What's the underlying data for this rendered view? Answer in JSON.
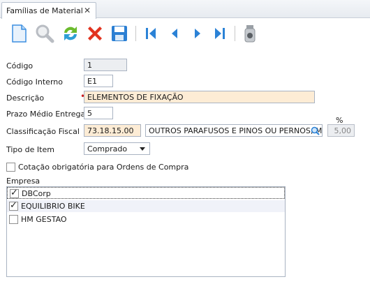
{
  "tab": {
    "title": "Famílias de Material",
    "close": "✕"
  },
  "toolbar": {
    "new": "new-document-icon",
    "search": "search-icon",
    "refresh": "refresh-icon",
    "delete": "delete-icon",
    "save": "save-icon",
    "first": "first-record-icon",
    "prev": "previous-record-icon",
    "next": "next-record-icon",
    "last": "last-record-icon",
    "extra": "dispenser-icon"
  },
  "form": {
    "codigo_label": "Código",
    "codigo_value": "1",
    "codigo_interno_label": "Código Interno",
    "codigo_interno_value": "E1",
    "descricao_label": "Descrição",
    "descricao_value": "ELEMENTOS DE FIXAÇÃO",
    "prazo_label": "Prazo Médio Entrega",
    "prazo_value": "5",
    "classificacao_label": "Classificação Fiscal",
    "classificacao_code": "73.18.15.00",
    "classificacao_desc": "OUTROS PARAFUSOS E PINOS OU PERNOS, MESI",
    "pct_label": "%",
    "pct_value": "5,00",
    "tipo_label": "Tipo de Item",
    "tipo_value": "Comprado",
    "cotacao_label": "Cotação obrigatória para Ordens de Compra",
    "cotacao_checked": false
  },
  "empresa": {
    "label": "Empresa",
    "items": [
      {
        "name": "DBCorp",
        "checked": true
      },
      {
        "name": "EQUILIBRIO BIKE",
        "checked": true
      },
      {
        "name": "HM GESTAO",
        "checked": false
      }
    ]
  },
  "colors": {
    "accent": "#1f7fd6",
    "required": "#cc1f1f",
    "highlight": "#fdecd5"
  }
}
